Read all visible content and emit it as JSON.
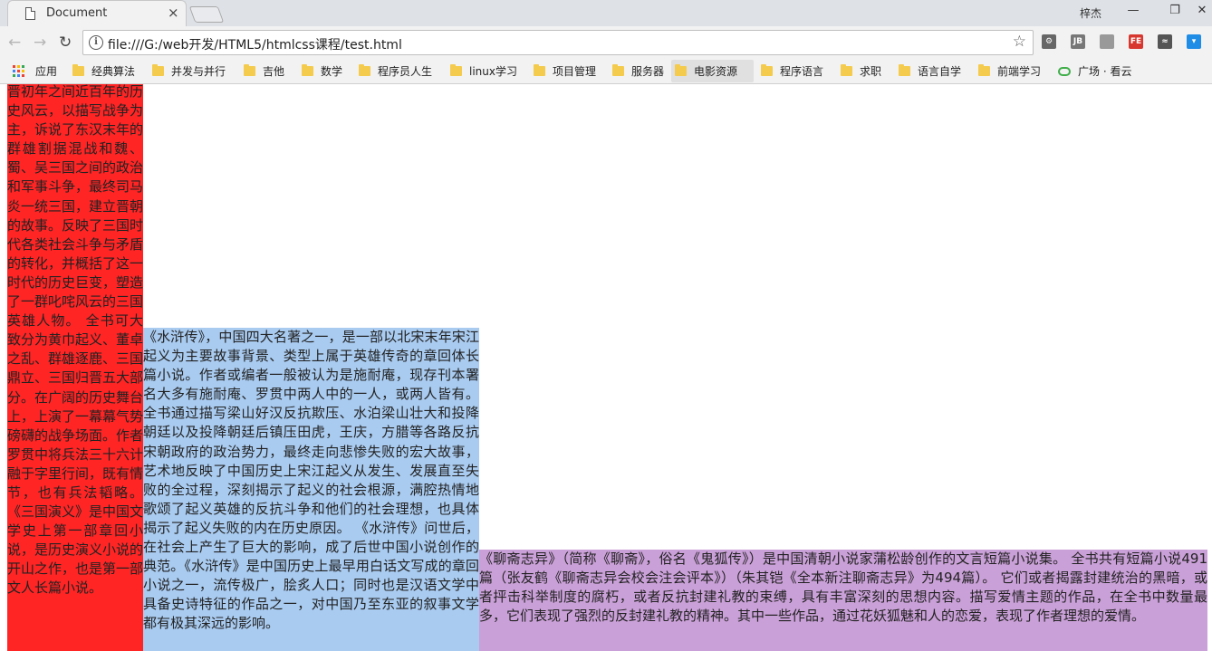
{
  "browser": {
    "tab_title": "Document",
    "tab_close": "×",
    "user_name": "梓杰",
    "window_controls": {
      "minimize": "—",
      "restore": "❐",
      "close": "✕"
    },
    "nav": {
      "back": "←",
      "forward": "→",
      "reload": "↻"
    },
    "url": "file:///G:/web开发/HTML5/htmlcss课程/test.html",
    "info_icon": "i",
    "star": "☆",
    "extensions": [
      {
        "name": "gear-extension-icon",
        "label": "⚙",
        "color": "#666666"
      },
      {
        "name": "jb-extension-icon",
        "label": "JB",
        "color": "#777777"
      },
      {
        "name": "puzzle-extension-icon",
        "label": "",
        "color": "#999999",
        "badge": "!"
      },
      {
        "name": "fe-extension-icon",
        "label": "FE",
        "color": "#d8372f"
      },
      {
        "name": "eye-extension-icon",
        "label": "≈",
        "color": "#555555"
      },
      {
        "name": "pocket-extension-icon",
        "label": "▾",
        "color": "#1f8ce6"
      }
    ]
  },
  "bookmarks": [
    {
      "label": "应用",
      "icon": "apps-grid-icon"
    },
    {
      "label": "经典算法",
      "icon": "folder-icon"
    },
    {
      "label": "并发与并行",
      "icon": "folder-icon"
    },
    {
      "label": "吉他",
      "icon": "folder-icon"
    },
    {
      "label": "数学",
      "icon": "folder-icon"
    },
    {
      "label": "程序员人生",
      "icon": "folder-icon"
    },
    {
      "label": "linux学习",
      "icon": "folder-icon"
    },
    {
      "label": "项目管理",
      "icon": "folder-icon"
    },
    {
      "label": "服务器",
      "icon": "folder-icon"
    },
    {
      "label": "电影资源",
      "icon": "folder-icon",
      "hover": true
    },
    {
      "label": "程序语言",
      "icon": "folder-icon"
    },
    {
      "label": "求职",
      "icon": "folder-icon"
    },
    {
      "label": "语言自学",
      "icon": "folder-icon"
    },
    {
      "label": "前端学习",
      "icon": "folder-icon"
    },
    {
      "label": "广场 · 看云",
      "icon": "cloud-icon"
    }
  ],
  "page": {
    "sanguo": "晋初年之间近百年的历史风云，以描写战争为主，诉说了东汉末年的群雄割据混战和魏、蜀、吴三国之间的政治和军事斗争，最终司马炎一统三国，建立晋朝的故事。反映了三国时代各类社会斗争与矛盾的转化，并概括了这一时代的历史巨变，塑造了一群叱咤风云的三国英雄人物。 全书可大致分为黄巾起义、董卓之乱、群雄逐鹿、三国鼎立、三国归晋五大部分。在广阔的历史舞台上，上演了一幕幕气势磅礴的战争场面。作者罗贯中将兵法三十六计融于字里行间，既有情节，也有兵法韬略。《三国演义》是中国文学史上第一部章回小说，是历史演义小说的开山之作，也是第一部文人长篇小说。",
    "shuihu": "《水浒传》，中国四大名著之一，是一部以北宋末年宋江起义为主要故事背景、类型上属于英雄传奇的章回体长篇小说。作者或编者一般被认为是施耐庵，现存刊本署名大多有施耐庵、罗贯中两人中的一人，或两人皆有。 全书通过描写梁山好汉反抗欺压、水泊梁山壮大和投降朝廷以及投降朝廷后镇压田虎，王庆，方腊等各路反抗宋朝政府的政治势力，最终走向悲惨失败的宏大故事，艺术地反映了中国历史上宋江起义从发生、发展直至失败的全过程，深刻揭示了起义的社会根源，满腔热情地歌颂了起义英雄的反抗斗争和他们的社会理想，也具体揭示了起义失败的内在历史原因。 《水浒传》问世后，在社会上产生了巨大的影响，成了后世中国小说创作的典范。《水浒传》是中国历史上最早用白话文写成的章回小说之一，流传极广，脍炙人口；同时也是汉语文学中具备史诗特征的作品之一，对中国乃至东亚的叙事文学都有极其深远的影响。",
    "liaozhai": "《聊斋志异》（简称《聊斋》，俗名《鬼狐传》）是中国清朝小说家蒲松龄创作的文言短篇小说集。 全书共有短篇小说491篇（张友鹤《聊斋志异会校会注会评本》）（朱其铠《全本新注聊斋志异》为494篇）。 它们或者揭露封建统治的黑暗，或者抨击科举制度的腐朽，或者反抗封建礼教的束缚，具有丰富深刻的思想内容。描写爱情主题的作品，在全书中数量最多，它们表现了强烈的反封建礼教的精神。其中一些作品，通过花妖狐魅和人的恋爱，表现了作者理想的爱情。"
  },
  "colors": {
    "red": "#ff2525",
    "blue": "#a9cbf0",
    "purple": "#caa0d8"
  }
}
